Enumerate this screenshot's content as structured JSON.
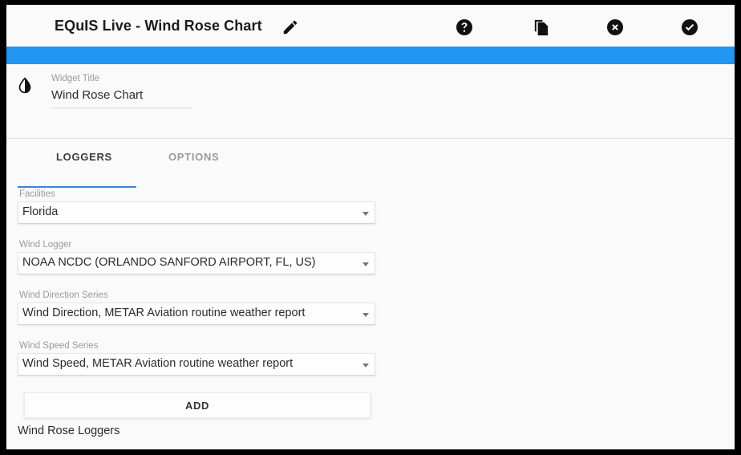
{
  "window": {
    "title": "EQuIS Live - Wind Rose Chart",
    "accent_color": "#2196f3",
    "background_color": "#fafafa"
  },
  "header": {
    "title": "EQuIS Live - Wind Rose Chart",
    "actions": [
      {
        "name": "edit-icon",
        "label": "Edit"
      },
      {
        "name": "help-icon",
        "label": "Help"
      },
      {
        "name": "copy-icon",
        "label": "Copy"
      },
      {
        "name": "close-icon",
        "label": "Close"
      },
      {
        "name": "check-icon",
        "label": "Save"
      }
    ]
  },
  "widget": {
    "icon": "contrast-droplet-icon",
    "title_caption": "Widget Title",
    "title_value": "Wind Rose Chart",
    "title_placeholder": "Widget Title"
  },
  "tabs": {
    "active": "LOGGERS",
    "items": [
      {
        "label": "LOGGERS",
        "active": true
      },
      {
        "label": "OPTIONS",
        "active": false
      }
    ],
    "underline_color": "#3a86d4"
  },
  "form": {
    "fields": [
      {
        "caption": "Facilities",
        "value": "Florida"
      },
      {
        "caption": "Wind Logger",
        "value": "NOAA NCDC (ORLANDO SANFORD AIRPORT, FL, US)"
      },
      {
        "caption": "Wind Direction Series",
        "value": "Wind Direction, METAR Aviation routine weather report"
      },
      {
        "caption": "Wind Speed Series",
        "value": "Wind Speed, METAR Aviation routine weather report"
      }
    ],
    "add_button_label": "ADD",
    "loggers_list_label": "Wind Rose Loggers"
  }
}
